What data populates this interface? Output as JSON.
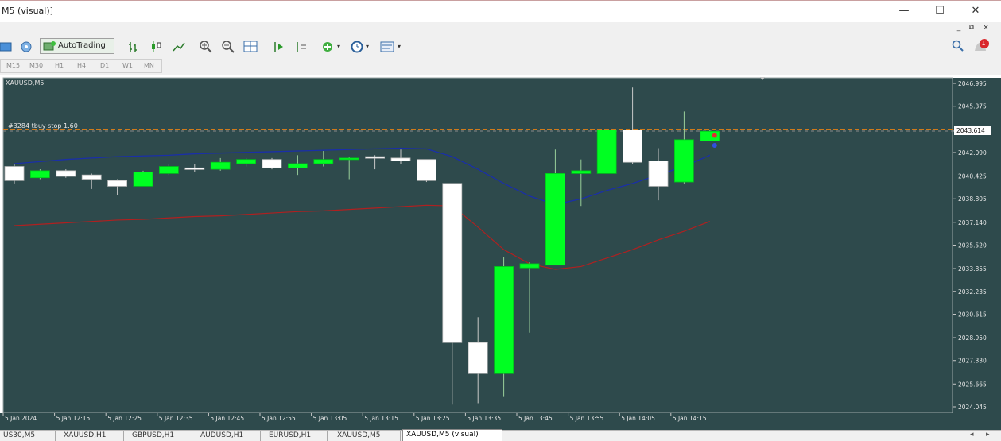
{
  "window": {
    "title": "M5 (visual)]",
    "minimize": "—",
    "maximize": "☐",
    "close": "✕"
  },
  "mdi": {
    "minimize": "_",
    "restore": "⧉",
    "close": "×"
  },
  "toolbar": {
    "autotrading_label": "AutoTrading",
    "alert_count": "1"
  },
  "timeframes": [
    "M15",
    "M30",
    "H1",
    "H4",
    "D1",
    "W1",
    "MN"
  ],
  "chart": {
    "symbol_label": "XAUUSD,M5",
    "order_label": "#3284 tbuy stop 1.60",
    "price_labels": [
      "2046.995",
      "2045.375",
      "2043.614",
      "2042.090",
      "2040.425",
      "2038.805",
      "2037.140",
      "2035.520",
      "2033.855",
      "2032.235",
      "2030.615",
      "2028.950",
      "2027.330",
      "2025.665",
      "2024.045"
    ],
    "time_labels": [
      "5 Jan 2024",
      "5 Jan 12:15",
      "5 Jan 12:25",
      "5 Jan 12:35",
      "5 Jan 12:45",
      "5 Jan 12:55",
      "5 Jan 13:05",
      "5 Jan 13:15",
      "5 Jan 13:25",
      "5 Jan 13:35",
      "5 Jan 13:45",
      "5 Jan 13:55",
      "5 Jan 14:05",
      "5 Jan 14:15"
    ],
    "current_price": "2043.614"
  },
  "chart_data": {
    "type": "candlestick",
    "symbol": "XAUUSD",
    "timeframe": "M5",
    "ylim": [
      2024.045,
      2046.995
    ],
    "current_price": 2043.614,
    "order_line": 2043.75,
    "candles": [
      {
        "o": 2041.1,
        "c": 2040.1,
        "h": 2041.3,
        "l": 2039.9
      },
      {
        "o": 2040.3,
        "c": 2040.8,
        "h": 2040.9,
        "l": 2040.2
      },
      {
        "o": 2040.8,
        "c": 2040.4,
        "h": 2040.9,
        "l": 2040.3
      },
      {
        "o": 2040.5,
        "c": 2040.2,
        "h": 2040.6,
        "l": 2039.5
      },
      {
        "o": 2040.1,
        "c": 2039.7,
        "h": 2040.2,
        "l": 2039.1
      },
      {
        "o": 2039.7,
        "c": 2040.7,
        "h": 2040.8,
        "l": 2039.7
      },
      {
        "o": 2040.6,
        "c": 2041.1,
        "h": 2041.3,
        "l": 2040.5
      },
      {
        "o": 2041.0,
        "c": 2040.9,
        "h": 2041.3,
        "l": 2040.7
      },
      {
        "o": 2040.9,
        "c": 2041.4,
        "h": 2041.7,
        "l": 2040.8
      },
      {
        "o": 2041.3,
        "c": 2041.6,
        "h": 2041.7,
        "l": 2041.1
      },
      {
        "o": 2041.6,
        "c": 2041.0,
        "h": 2041.7,
        "l": 2040.9
      },
      {
        "o": 2041.0,
        "c": 2041.3,
        "h": 2041.9,
        "l": 2040.5
      },
      {
        "o": 2041.3,
        "c": 2041.6,
        "h": 2042.2,
        "l": 2041.1
      },
      {
        "o": 2041.6,
        "c": 2041.7,
        "h": 2041.8,
        "l": 2040.2
      },
      {
        "o": 2041.8,
        "c": 2041.7,
        "h": 2041.9,
        "l": 2040.9
      },
      {
        "o": 2041.7,
        "c": 2041.5,
        "h": 2042.3,
        "l": 2041.3
      },
      {
        "o": 2041.6,
        "c": 2040.1,
        "h": 2041.6,
        "l": 2040.0
      },
      {
        "o": 2039.9,
        "c": 2028.6,
        "h": 2039.9,
        "l": 2024.2
      },
      {
        "o": 2028.6,
        "c": 2026.4,
        "h": 2030.4,
        "l": 2024.3
      },
      {
        "o": 2026.4,
        "c": 2034.0,
        "h": 2034.7,
        "l": 2024.8
      },
      {
        "o": 2033.9,
        "c": 2034.2,
        "h": 2034.3,
        "l": 2029.3
      },
      {
        "o": 2034.1,
        "c": 2040.6,
        "h": 2042.3,
        "l": 2034.1
      },
      {
        "o": 2040.6,
        "c": 2040.8,
        "h": 2041.6,
        "l": 2038.3
      },
      {
        "o": 2040.6,
        "c": 2043.7,
        "h": 2043.7,
        "l": 2040.6
      },
      {
        "o": 2043.7,
        "c": 2041.4,
        "h": 2046.7,
        "l": 2041.3
      },
      {
        "o": 2041.5,
        "c": 2039.7,
        "h": 2042.4,
        "l": 2038.7
      },
      {
        "o": 2040.0,
        "c": 2043.0,
        "h": 2045.0,
        "l": 2039.9
      },
      {
        "o": 2042.9,
        "c": 2043.6,
        "h": 2043.7,
        "l": 2042.9
      }
    ],
    "ma_blue": [
      2041.3,
      2041.45,
      2041.6,
      2041.7,
      2041.8,
      2041.85,
      2041.9,
      2042.0,
      2042.05,
      2042.1,
      2042.15,
      2042.2,
      2042.25,
      2042.3,
      2042.35,
      2042.4,
      2042.35,
      2041.8,
      2040.9,
      2039.9,
      2039.0,
      2038.4,
      2038.8,
      2039.4,
      2039.9,
      2040.5,
      2041.1,
      2041.9
    ],
    "ma_red": [
      2036.9,
      2037.0,
      2037.1,
      2037.2,
      2037.3,
      2037.35,
      2037.45,
      2037.55,
      2037.6,
      2037.7,
      2037.8,
      2037.9,
      2037.95,
      2038.05,
      2038.15,
      2038.25,
      2038.35,
      2038.3,
      2036.8,
      2035.2,
      2034.2,
      2033.8,
      2034.0,
      2034.6,
      2035.2,
      2035.9,
      2036.5,
      2037.2
    ]
  }
}
